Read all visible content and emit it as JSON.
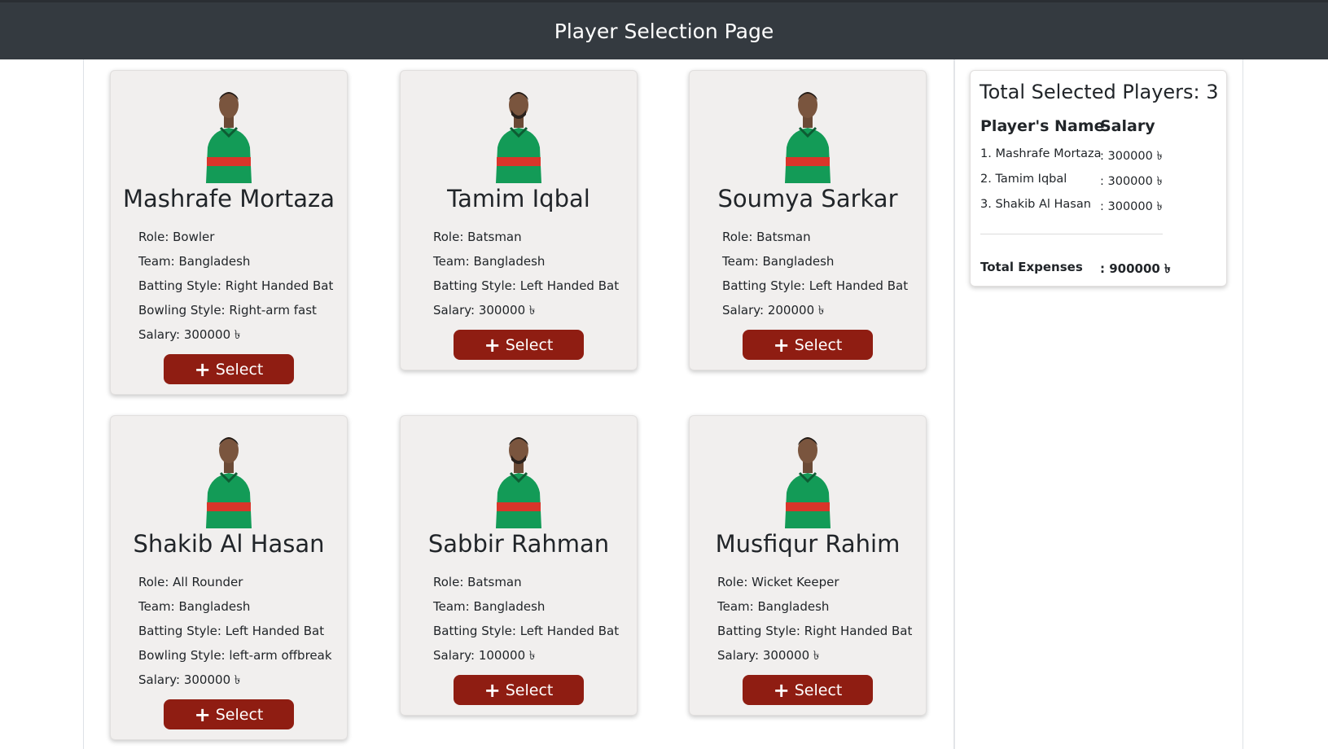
{
  "header": {
    "title": "Player Selection Page"
  },
  "players": [
    {
      "name": "Mashrafe Mortaza",
      "role": "Role: Bowler",
      "team": "Team: Bangladesh",
      "batting": "Batting Style: Right Handed Bat",
      "bowling": "Bowling Style: Right-arm fast",
      "salary": "Salary: 300000 ৳",
      "button": "Select"
    },
    {
      "name": "Tamim Iqbal",
      "role": "Role: Batsman",
      "team": "Team: Bangladesh",
      "batting": "Batting Style: Left Handed Bat",
      "salary": "Salary: 300000 ৳",
      "button": "Select"
    },
    {
      "name": "Soumya Sarkar",
      "role": "Role: Batsman",
      "team": "Team: Bangladesh",
      "batting": "Batting Style: Left Handed Bat",
      "salary": "Salary: 200000 ৳",
      "button": "Select"
    },
    {
      "name": "Shakib Al Hasan",
      "role": "Role: All Rounder",
      "team": "Team: Bangladesh",
      "batting": "Batting Style: Left Handed Bat",
      "bowling": "Bowling Style: left-arm offbreak",
      "salary": "Salary: 300000 ৳",
      "button": "Select"
    },
    {
      "name": "Sabbir Rahman",
      "role": "Role: Batsman",
      "team": "Team: Bangladesh",
      "batting": "Batting Style: Left Handed Bat",
      "salary": "Salary: 100000 ৳",
      "button": "Select"
    },
    {
      "name": "Musfiqur Rahim",
      "role": "Role: Wicket Keeper",
      "team": "Team: Bangladesh",
      "batting": "Batting Style: Right Handed Bat",
      "salary": "Salary: 300000 ৳",
      "button": "Select"
    }
  ],
  "summary": {
    "title": "Total Selected Players: 3",
    "col_name": "Player's Name",
    "col_salary": "Salary",
    "rows": [
      {
        "name": "1. Mashrafe Mortaza",
        "salary": ": 300000 ৳"
      },
      {
        "name": "2. Tamim Iqbal",
        "salary": ": 300000 ৳"
      },
      {
        "name": "3. Shakib Al Hasan",
        "salary": ": 300000 ৳"
      }
    ],
    "total_label": "Total Expenses",
    "total_value": ": 900000 ৳"
  },
  "colors": {
    "header_bg": "#343a40",
    "button_bg": "#8f1d12",
    "card_bg": "#f1efee",
    "jersey_green": "#139b57",
    "jersey_red": "#d9352a"
  },
  "icons": {
    "select_button": "plus-icon",
    "photo": "player-avatar-icon"
  }
}
